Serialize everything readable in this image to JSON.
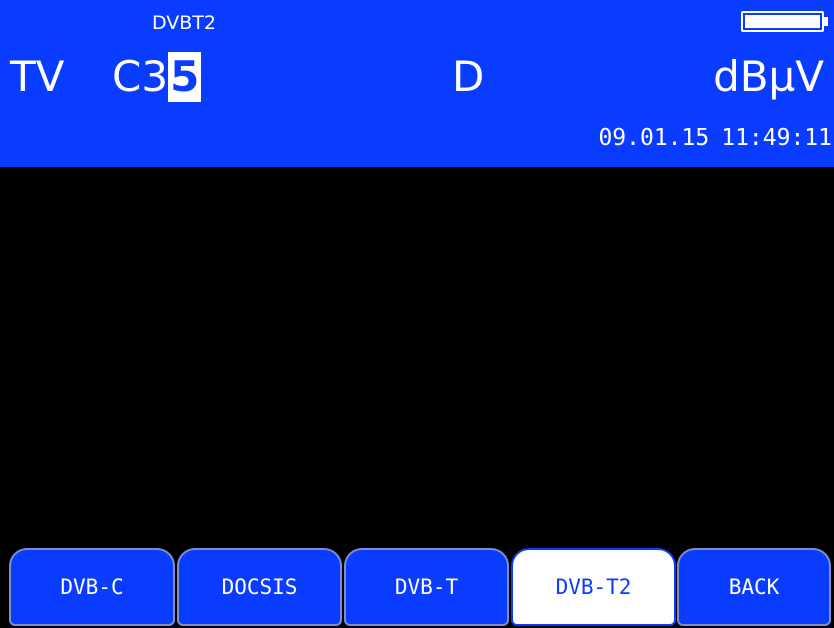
{
  "header": {
    "standard": "DVBT2",
    "mode": "TV",
    "channel_prefix": "C3",
    "channel_cursor_digit": "5",
    "band": "D",
    "unit": "dBµV",
    "date": "09.01.15",
    "time": "11:49:11",
    "battery_icon": "battery-full-icon",
    "battery_level": 1.0
  },
  "softkeys": [
    {
      "label": "DVB-C",
      "active": false
    },
    {
      "label": "DOCSIS",
      "active": false
    },
    {
      "label": "DVB-T",
      "active": false
    },
    {
      "label": "DVB-T2",
      "active": true
    },
    {
      "label": "BACK",
      "active": false
    }
  ],
  "colors": {
    "header_background": "#0a3cff",
    "display_background": "#000000",
    "softkey_background": "#0a3cff",
    "softkey_active_background": "#ffffff",
    "text": "#ffffff"
  }
}
